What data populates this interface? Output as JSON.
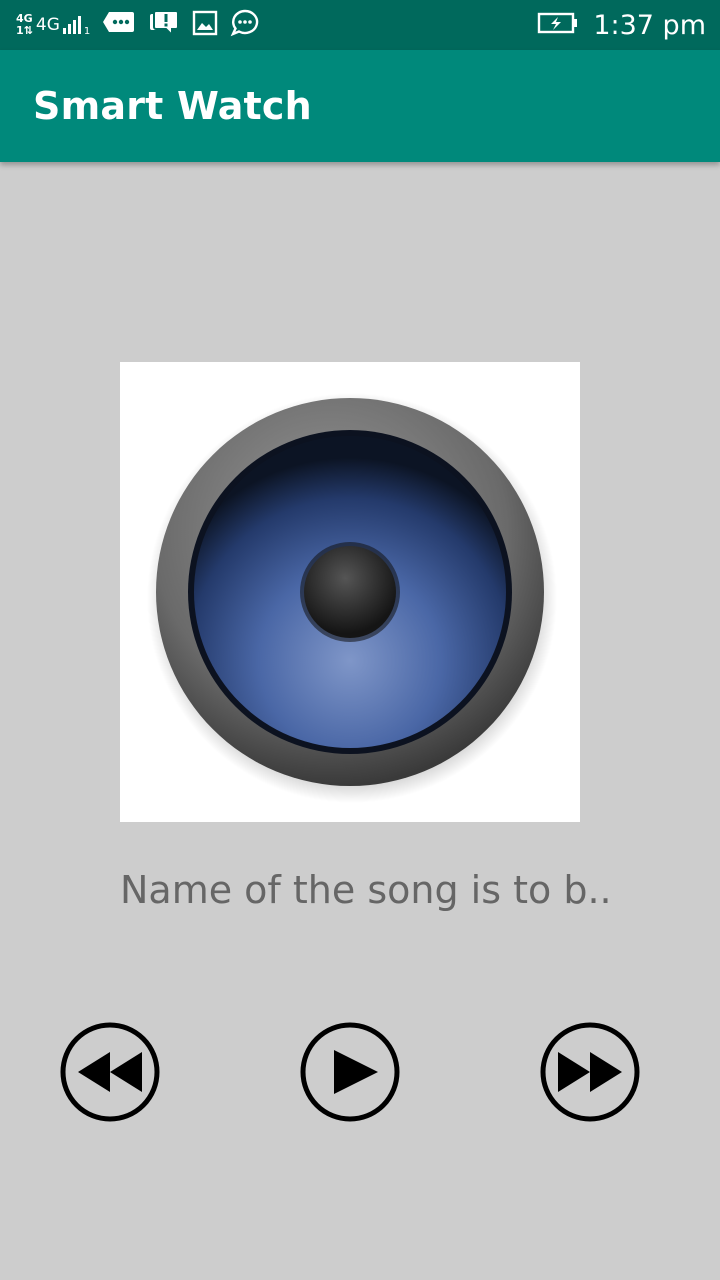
{
  "status_bar": {
    "network_top": "4G",
    "network_bottom": "1⇅",
    "network_main": "4G",
    "sim_index": "1",
    "time": "1:37 pm",
    "notification_icons": [
      "message-icon",
      "alert-chat-icon",
      "gallery-icon",
      "chat-bubble-icon"
    ]
  },
  "app_bar": {
    "title": "Smart Watch",
    "color": "#00897b"
  },
  "player": {
    "album_art_icon": "speaker-icon",
    "song_name": "Name of the song is to b..",
    "controls": {
      "rewind_icon": "rewind-icon",
      "play_icon": "play-icon",
      "fast_forward_icon": "fast-forward-icon"
    }
  }
}
